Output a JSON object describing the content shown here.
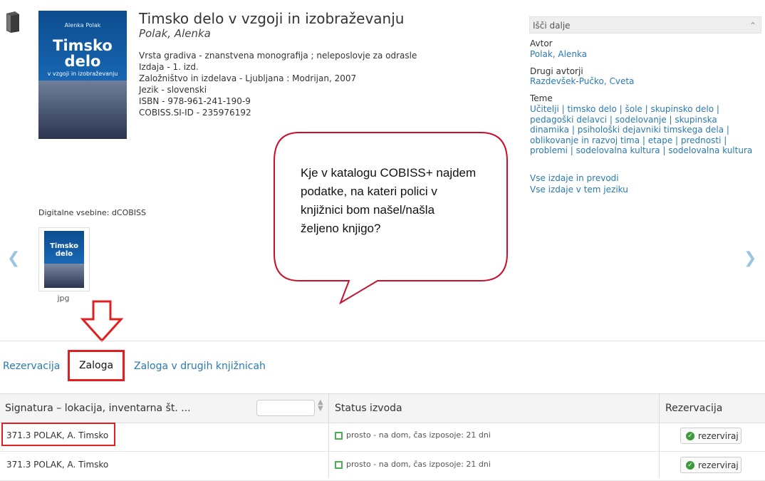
{
  "record": {
    "title": "Timsko delo v vzgoji in izobraževanju",
    "author": "Polak, Alenka",
    "meta": [
      {
        "label": "Vrsta gradiva",
        "value": " - znanstvena monografija ; neleposlovje za odrasle"
      },
      {
        "label": "Izdaja",
        "value": " - 1. izd."
      },
      {
        "label": "Založništvo in izdelava",
        "value": " - Ljubljana : Modrijan, 2007"
      },
      {
        "label": "Jezik",
        "value": " - slovenski"
      },
      {
        "label": "ISBN",
        "value": " - 978-961-241-190-9"
      },
      {
        "label": "COBISS.SI-ID",
        "value": " - 235976192"
      }
    ]
  },
  "cover": {
    "author": "Alenka Polak",
    "title_line1": "Timsko",
    "title_line2": "delo",
    "subtitle": "v vzgoji in izobraževanju"
  },
  "digital": {
    "label": "Digitalne vsebine: dCOBISS",
    "thumb_caption": "jpg",
    "thumb_title1": "Timsko",
    "thumb_title2": "delo"
  },
  "right_panel": {
    "search_more": "Išči dalje",
    "author_label": "Avtor",
    "author_value": "Polak, Alenka",
    "other_authors_label": "Drugi avtorji",
    "other_authors_value": "Razdevšek-Pučko, Cveta",
    "topics_label": "Teme",
    "topics_lines": [
      "Učitelji | timsko delo | šole | skupinsko delo |",
      "pedagoški delavci | sodelovanje | skupinska",
      "dinamika | psihološki dejavniki timskega dela |",
      "oblikovanje in razvoj tima | etape | prednosti |",
      "problemi | sodelovalna kultura | sodelovalna kultura"
    ],
    "all_editions": "Vse izdaje in prevodi",
    "all_in_language": "Vse izdaje v tem jeziku"
  },
  "bubble": {
    "lines": [
      "Kje v katalogu COBISS+ najdem",
      "podatke, na kateri polici v",
      "knjižnici bom našel/našla",
      "željeno knjigo?"
    ]
  },
  "tabs": {
    "reservation": "Rezervacija",
    "holdings": "Zaloga",
    "holdings_other": "Zaloga v drugih knjižnicah"
  },
  "table": {
    "headers": {
      "signature": "Signatura – lokacija, inventarna št. ...",
      "status": "Status izvoda",
      "reservation": "Rezervacija"
    },
    "rows": [
      {
        "signature": "371.3 POLAK, A. Timsko",
        "status": "prosto - na dom, čas izposoje: 21 dni",
        "button": "rezerviraj"
      },
      {
        "signature": "371.3 POLAK, A. Timsko",
        "status": "prosto - na dom, čas izposoje: 21 dni",
        "button": "rezerviraj"
      }
    ]
  },
  "icons": {
    "book": "book-icon",
    "prev": "chevron-left-icon",
    "next": "chevron-right-icon",
    "collapse": "chevron-up-icon",
    "sort": "sort-icon",
    "check": "check-circle-icon"
  },
  "colors": {
    "link": "#2a7ab0",
    "highlight": "#e02020",
    "status_ok": "#4caf50"
  }
}
